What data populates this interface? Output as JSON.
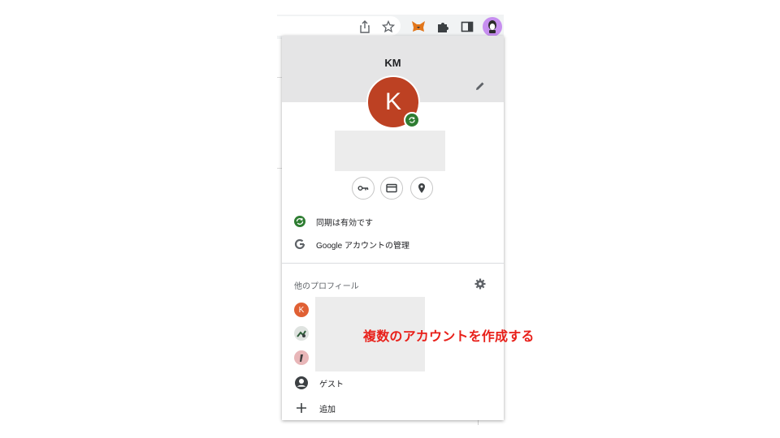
{
  "profile": {
    "name": "KM",
    "avatar_letter": "K",
    "avatar_color": "#bd4123"
  },
  "quick_actions": [
    "password-key-icon",
    "payment-card-icon",
    "address-pin-icon"
  ],
  "menu": {
    "sync_status": "同期は有効です",
    "manage_account": "Google アカウントの管理"
  },
  "other_profiles": {
    "title": "他のプロフィール",
    "items": [
      {
        "initial": "K",
        "color": "#e06034"
      },
      {
        "initial": "",
        "color": "#dfe3e0"
      },
      {
        "initial": "",
        "color": "#e8b6b8"
      }
    ],
    "guest_label": "ゲスト",
    "add_label": "追加"
  },
  "annotation": "複数のアカウントを作成する",
  "colors": {
    "accent_red": "#e8201a",
    "sync_green": "#2e7d32"
  }
}
